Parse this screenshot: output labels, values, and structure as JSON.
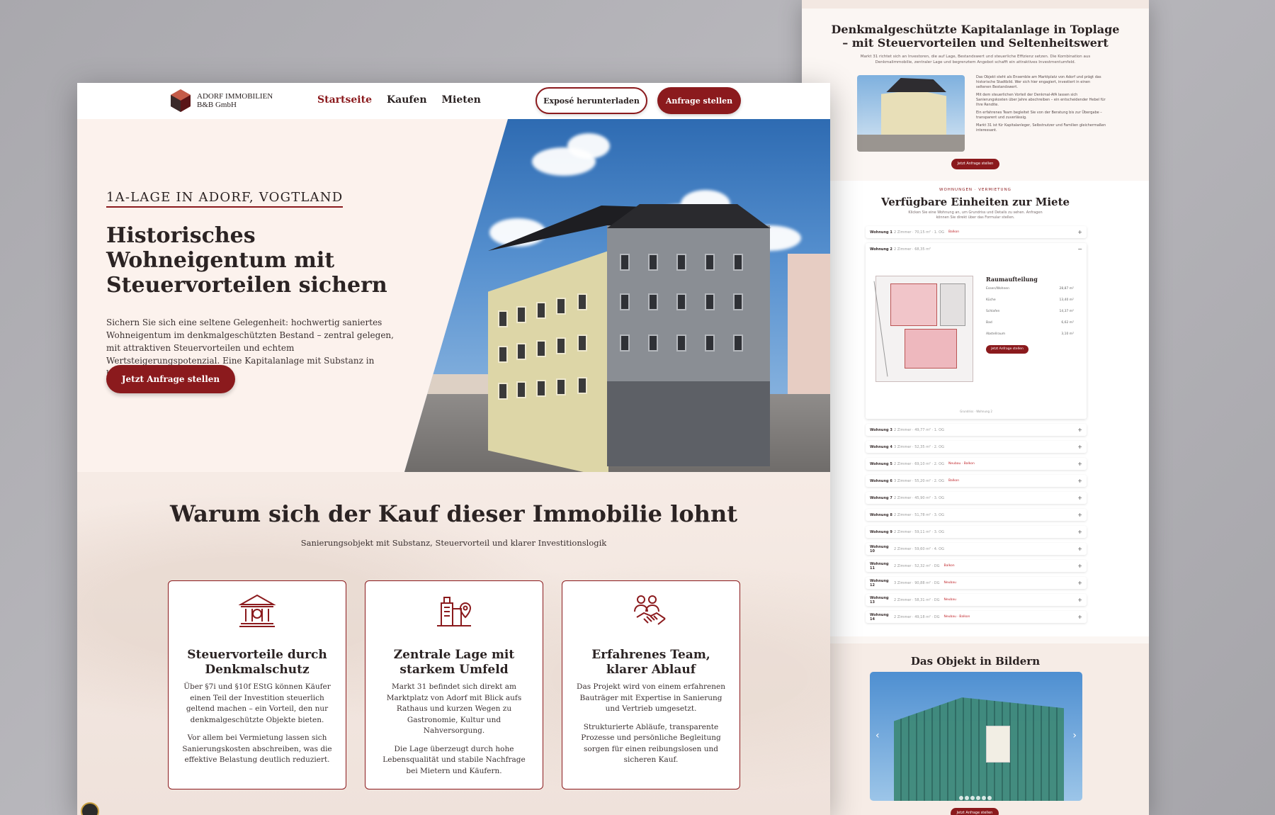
{
  "right_page": {
    "invest": {
      "title": "Denkmalgeschützte Kapitalanlage in Toplage – mit Steuervorteilen und Seltenheitswert",
      "intro": "Markt 31 richtet sich an Investoren, die auf Lage, Bestandswert und steuerliche Effizienz setzen. Die Kombination aus Denkmalimmobilie, zentraler Lage und begrenztem Angebot schafft ein attraktives Investmentumfeld.",
      "paragraphs": [
        "Das Objekt steht als Ensemble am Marktplatz von Adorf und prägt das historische Stadtbild. Wer sich hier engagiert, investiert in einen seltenen Bestandswert.",
        "Mit dem steuerlichen Vorteil der Denkmal-AfA lassen sich Sanierungskosten über Jahre abschreiben – ein entscheidender Hebel für Ihre Rendite.",
        "Ein erfahrenes Team begleitet Sie von der Beratung bis zur Übergabe – transparent und zuverlässig.",
        "Markt 31 ist für Kapitalanleger, Selbstnutzer und Familien gleichermaßen interessant."
      ],
      "cta": "Jetzt Anfrage stellen"
    },
    "units": {
      "kicker": "WOHNUNGEN · VERMIETUNG",
      "title": "Verfügbare Einheiten zur Miete",
      "subtitle": "Klicken Sie eine Wohnung an, um Grundriss und Details zu sehen. Anfragen können Sie direkt über das Formular stellen.",
      "open_unit": {
        "name": "Wohnung 2",
        "meta": "2 Zimmer · 68,35 m²",
        "room_title": "Raumaufteilung",
        "rooms": [
          {
            "label": "Essen/Wohnen",
            "value": "28,87 m²"
          },
          {
            "label": "Küche",
            "value": "13,40 m²"
          },
          {
            "label": "Schlafen",
            "value": "14,37 m²"
          },
          {
            "label": "Bad",
            "value": "6,62 m²"
          },
          {
            "label": "Abstellraum",
            "value": "3,10 m²"
          }
        ],
        "cta": "Jetzt Anfrage stellen",
        "caption": "Grundriss · Wohnung 2"
      },
      "rows": [
        {
          "name": "Wohnung 1",
          "meta": "2 Zimmer · 70,15 m² · 1. OG",
          "tag": "Balkon"
        },
        {
          "name": "Wohnung 3",
          "meta": "2 Zimmer · 49,77 m² · 1. OG",
          "tag": ""
        },
        {
          "name": "Wohnung 4",
          "meta": "3 Zimmer · 52,35 m² · 2. OG",
          "tag": ""
        },
        {
          "name": "Wohnung 5",
          "meta": "2 Zimmer · 69,10 m² · 2. OG",
          "tag": "Neubau · Balkon"
        },
        {
          "name": "Wohnung 6",
          "meta": "3 Zimmer · 55,20 m² · 2. OG",
          "tag": "Balkon"
        },
        {
          "name": "Wohnung 7",
          "meta": "2 Zimmer · 45,90 m² · 3. OG",
          "tag": ""
        },
        {
          "name": "Wohnung 8",
          "meta": "2 Zimmer · 51,78 m² · 3. OG",
          "tag": ""
        },
        {
          "name": "Wohnung 9",
          "meta": "2 Zimmer · 59,11 m² · 3. OG",
          "tag": ""
        },
        {
          "name": "Wohnung 10",
          "meta": "2 Zimmer · 59,60 m² · 4. OG",
          "tag": ""
        },
        {
          "name": "Wohnung 11",
          "meta": "2 Zimmer · 52,32 m² · DG",
          "tag": "Balkon"
        },
        {
          "name": "Wohnung 12",
          "meta": "3 Zimmer · 90,88 m² · DG",
          "tag": "Neubau"
        },
        {
          "name": "Wohnung 13",
          "meta": "2 Zimmer · 58,31 m² · DG",
          "tag": "Neubau"
        },
        {
          "name": "Wohnung 14",
          "meta": "2 Zimmer · 49,18 m² · DG",
          "tag": "Neubau · Balkon"
        }
      ]
    },
    "gallery": {
      "title": "Das Objekt in Bildern",
      "cta": "Jetzt Anfrage stellen"
    }
  },
  "main": {
    "nav": {
      "logo_line1": "ADORF IMMOBILIEN",
      "logo_line2": "B&B GmbH",
      "links": [
        "Startseite",
        "Kaufen",
        "Mieten"
      ],
      "btn_expose": "Exposé herunterladen",
      "btn_anfrage": "Anfrage stellen"
    },
    "hero": {
      "eyebrow": "1A-LAGE IN ADORF, VOGTLAND",
      "title": "Historisches Wohneigentum mit Steuervorteilen sichern",
      "text": "Sichern Sie sich eine seltene Gelegenheit: hochwertig saniertes Wohneigentum im denkmalgeschützten Bestand – zentral gelegen, mit attraktiven Steuervorteilen und echtem Wertsteigerungspotenzial. Eine Kapitalanlage mit Substanz in bester Lage.",
      "cta": "Jetzt Anfrage stellen"
    },
    "why": {
      "title": "Warum sich der Kauf dieser Immobilie lohnt",
      "subtitle": "Sanierungsobjekt mit Substanz, Steuervorteil und klarer Investitionslogik",
      "cards": [
        {
          "icon": "bank-icon",
          "title": "Steuervorteile durch Denkmalschutz",
          "p1": "Über §7i und §10f EStG können Käufer einen Teil der Investition steuerlich geltend machen – ein Vorteil, den nur denkmalgeschützte Objekte bieten.",
          "p2": "Vor allem bei Vermietung lassen sich Sanierungskosten abschreiben, was die effektive Belastung deutlich reduziert."
        },
        {
          "icon": "city-location-icon",
          "title": "Zentrale Lage mit starkem Umfeld",
          "p1": "Markt 31 befindet sich direkt am Marktplatz von Adorf mit Blick aufs Rathaus und kurzen Wegen zu Gastronomie, Kultur und Nahversorgung.",
          "p2": "Die Lage überzeugt durch hohe Lebensqualität und stabile Nachfrage bei Mietern und Käufern."
        },
        {
          "icon": "handshake-icon",
          "title": "Erfahrenes Team, klarer Ablauf",
          "p1": "Das Projekt wird von einem erfahrenen Bauträger mit Expertise in Sanierung und Vertrieb umgesetzt.",
          "p2": "Strukturierte Abläufe, transparente Prozesse und persönliche Begleitung sorgen für einen reibungslosen und sicheren Kauf."
        }
      ]
    }
  },
  "colors": {
    "accent": "#8b1a1d",
    "hero_bg": "#fcf2ed",
    "text": "#2b2323"
  }
}
